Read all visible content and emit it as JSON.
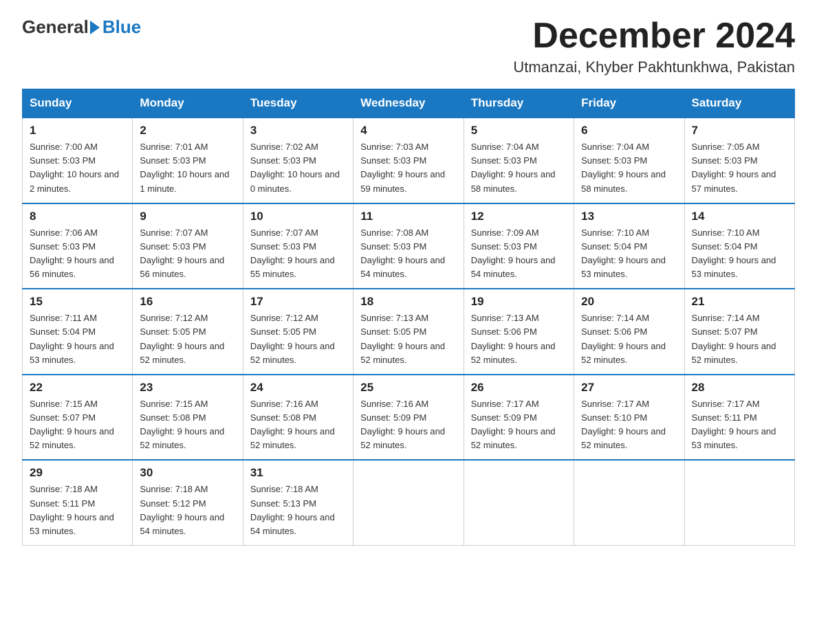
{
  "logo": {
    "general": "General",
    "blue": "Blue"
  },
  "title": "December 2024",
  "subtitle": "Utmanzai, Khyber Pakhtunkhwa, Pakistan",
  "days_of_week": [
    "Sunday",
    "Monday",
    "Tuesday",
    "Wednesday",
    "Thursday",
    "Friday",
    "Saturday"
  ],
  "weeks": [
    [
      {
        "day": "1",
        "sunrise": "7:00 AM",
        "sunset": "5:03 PM",
        "daylight": "10 hours and 2 minutes."
      },
      {
        "day": "2",
        "sunrise": "7:01 AM",
        "sunset": "5:03 PM",
        "daylight": "10 hours and 1 minute."
      },
      {
        "day": "3",
        "sunrise": "7:02 AM",
        "sunset": "5:03 PM",
        "daylight": "10 hours and 0 minutes."
      },
      {
        "day": "4",
        "sunrise": "7:03 AM",
        "sunset": "5:03 PM",
        "daylight": "9 hours and 59 minutes."
      },
      {
        "day": "5",
        "sunrise": "7:04 AM",
        "sunset": "5:03 PM",
        "daylight": "9 hours and 58 minutes."
      },
      {
        "day": "6",
        "sunrise": "7:04 AM",
        "sunset": "5:03 PM",
        "daylight": "9 hours and 58 minutes."
      },
      {
        "day": "7",
        "sunrise": "7:05 AM",
        "sunset": "5:03 PM",
        "daylight": "9 hours and 57 minutes."
      }
    ],
    [
      {
        "day": "8",
        "sunrise": "7:06 AM",
        "sunset": "5:03 PM",
        "daylight": "9 hours and 56 minutes."
      },
      {
        "day": "9",
        "sunrise": "7:07 AM",
        "sunset": "5:03 PM",
        "daylight": "9 hours and 56 minutes."
      },
      {
        "day": "10",
        "sunrise": "7:07 AM",
        "sunset": "5:03 PM",
        "daylight": "9 hours and 55 minutes."
      },
      {
        "day": "11",
        "sunrise": "7:08 AM",
        "sunset": "5:03 PM",
        "daylight": "9 hours and 54 minutes."
      },
      {
        "day": "12",
        "sunrise": "7:09 AM",
        "sunset": "5:03 PM",
        "daylight": "9 hours and 54 minutes."
      },
      {
        "day": "13",
        "sunrise": "7:10 AM",
        "sunset": "5:04 PM",
        "daylight": "9 hours and 53 minutes."
      },
      {
        "day": "14",
        "sunrise": "7:10 AM",
        "sunset": "5:04 PM",
        "daylight": "9 hours and 53 minutes."
      }
    ],
    [
      {
        "day": "15",
        "sunrise": "7:11 AM",
        "sunset": "5:04 PM",
        "daylight": "9 hours and 53 minutes."
      },
      {
        "day": "16",
        "sunrise": "7:12 AM",
        "sunset": "5:05 PM",
        "daylight": "9 hours and 52 minutes."
      },
      {
        "day": "17",
        "sunrise": "7:12 AM",
        "sunset": "5:05 PM",
        "daylight": "9 hours and 52 minutes."
      },
      {
        "day": "18",
        "sunrise": "7:13 AM",
        "sunset": "5:05 PM",
        "daylight": "9 hours and 52 minutes."
      },
      {
        "day": "19",
        "sunrise": "7:13 AM",
        "sunset": "5:06 PM",
        "daylight": "9 hours and 52 minutes."
      },
      {
        "day": "20",
        "sunrise": "7:14 AM",
        "sunset": "5:06 PM",
        "daylight": "9 hours and 52 minutes."
      },
      {
        "day": "21",
        "sunrise": "7:14 AM",
        "sunset": "5:07 PM",
        "daylight": "9 hours and 52 minutes."
      }
    ],
    [
      {
        "day": "22",
        "sunrise": "7:15 AM",
        "sunset": "5:07 PM",
        "daylight": "9 hours and 52 minutes."
      },
      {
        "day": "23",
        "sunrise": "7:15 AM",
        "sunset": "5:08 PM",
        "daylight": "9 hours and 52 minutes."
      },
      {
        "day": "24",
        "sunrise": "7:16 AM",
        "sunset": "5:08 PM",
        "daylight": "9 hours and 52 minutes."
      },
      {
        "day": "25",
        "sunrise": "7:16 AM",
        "sunset": "5:09 PM",
        "daylight": "9 hours and 52 minutes."
      },
      {
        "day": "26",
        "sunrise": "7:17 AM",
        "sunset": "5:09 PM",
        "daylight": "9 hours and 52 minutes."
      },
      {
        "day": "27",
        "sunrise": "7:17 AM",
        "sunset": "5:10 PM",
        "daylight": "9 hours and 52 minutes."
      },
      {
        "day": "28",
        "sunrise": "7:17 AM",
        "sunset": "5:11 PM",
        "daylight": "9 hours and 53 minutes."
      }
    ],
    [
      {
        "day": "29",
        "sunrise": "7:18 AM",
        "sunset": "5:11 PM",
        "daylight": "9 hours and 53 minutes."
      },
      {
        "day": "30",
        "sunrise": "7:18 AM",
        "sunset": "5:12 PM",
        "daylight": "9 hours and 54 minutes."
      },
      {
        "day": "31",
        "sunrise": "7:18 AM",
        "sunset": "5:13 PM",
        "daylight": "9 hours and 54 minutes."
      },
      null,
      null,
      null,
      null
    ]
  ]
}
